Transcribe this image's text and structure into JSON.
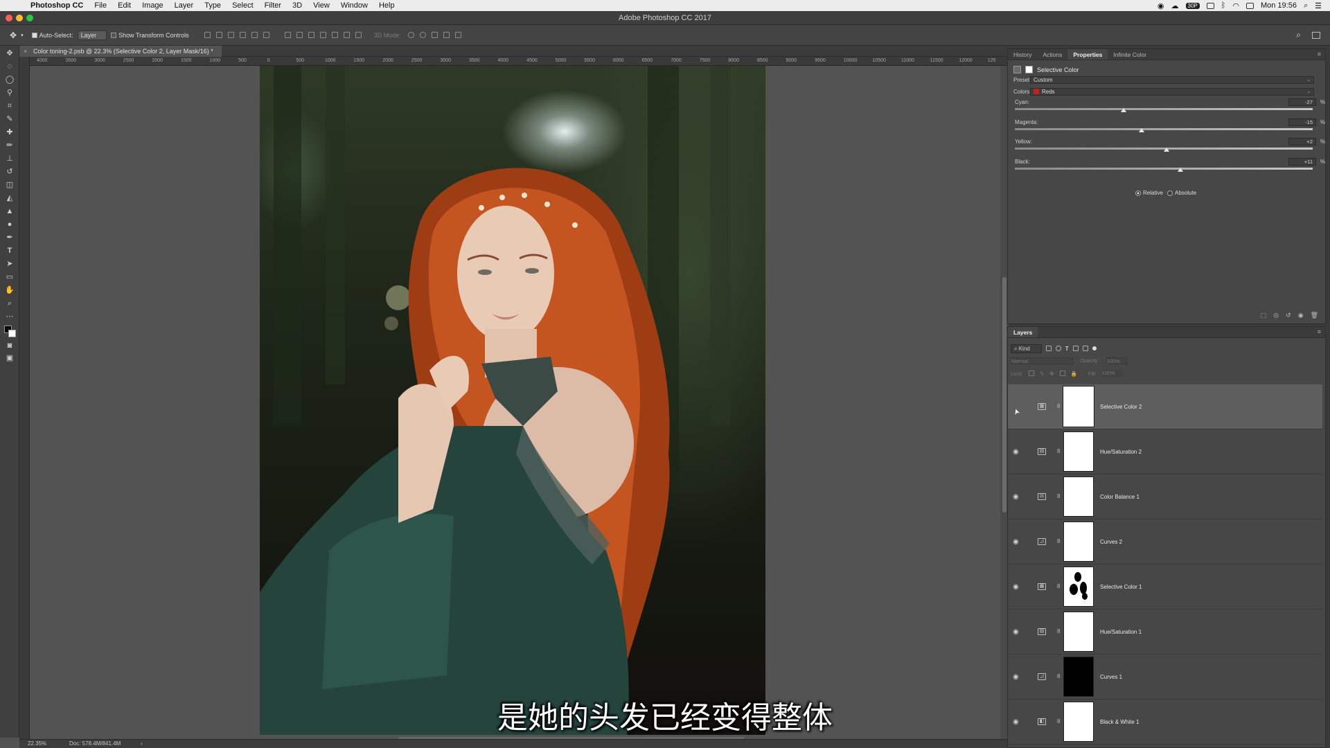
{
  "menubar": {
    "app": "Photoshop CC",
    "items": [
      "File",
      "Edit",
      "Image",
      "Layer",
      "Type",
      "Select",
      "Filter",
      "3D",
      "View",
      "Window",
      "Help"
    ],
    "clock": "Mon 19:56",
    "badge": "30P"
  },
  "window": {
    "title": "Adobe Photoshop CC 2017"
  },
  "options": {
    "auto_select_label": "Auto-Select:",
    "auto_select_value": "Layer",
    "transform_label": "Show Transform Controls",
    "mode3d": "3D Mode:"
  },
  "document": {
    "tab_title": "Color toning-2.psb @ 22.3% (Selective Color 2, Layer Mask/16) *",
    "zoom": "22.35%",
    "doc_info": "Doc: 578.4M/841.4M"
  },
  "ruler": {
    "ticks": [
      "4000",
      "3500",
      "3000",
      "2500",
      "2000",
      "1500",
      "1000",
      "500",
      "0",
      "500",
      "1000",
      "1500",
      "2000",
      "2500",
      "3000",
      "3500",
      "4000",
      "4500",
      "5000",
      "5500",
      "6000",
      "6500",
      "7000",
      "7500",
      "8000",
      "8500",
      "9000",
      "9500",
      "10000",
      "10500",
      "11000",
      "11500",
      "12000",
      "125"
    ]
  },
  "subtitle": "是她的头发已经变得整体",
  "properties_panel": {
    "tabs": [
      "History",
      "Actions",
      "Properties",
      "Infinite Color"
    ],
    "active_tab": "Properties",
    "title": "Selective Color",
    "preset_label": "Preset:",
    "preset_value": "Custom",
    "colors_label": "Colors:",
    "colors_value": "Reds",
    "colors_swatch": "#c0241b",
    "sliders": [
      {
        "label": "Cyan:",
        "value": "-27",
        "unit": "%",
        "percent": -27
      },
      {
        "label": "Magenta:",
        "value": "-15",
        "unit": "%",
        "percent": -15
      },
      {
        "label": "Yellow:",
        "value": "+2",
        "unit": "%",
        "percent": 2
      },
      {
        "label": "Black:",
        "value": "+11",
        "unit": "%",
        "percent": 11
      }
    ],
    "method_relative": "Relative",
    "method_absolute": "Absolute",
    "method_selected": "Relative"
  },
  "layers_panel": {
    "title": "Layers",
    "filter_kind": "Kind",
    "blend_mode": "Normal",
    "opacity_label": "Opacity:",
    "opacity_value": "100%",
    "lock_label": "Lock:",
    "fill_label": "Fill:",
    "fill_value": "100%",
    "layers": [
      {
        "name": "Selective Color 2",
        "type": "selective-color",
        "mask": "white",
        "selected": true,
        "visible": false
      },
      {
        "name": "Hue/Saturation 2",
        "type": "hue-saturation",
        "mask": "white",
        "selected": false,
        "visible": true
      },
      {
        "name": "Color Balance 1",
        "type": "color-balance",
        "mask": "white",
        "selected": false,
        "visible": true
      },
      {
        "name": "Curves 2",
        "type": "curves",
        "mask": "white",
        "selected": false,
        "visible": true
      },
      {
        "name": "Selective Color 1",
        "type": "selective-color",
        "mask": "painted",
        "selected": false,
        "visible": true
      },
      {
        "name": "Hue/Saturation 1",
        "type": "hue-saturation",
        "mask": "white",
        "selected": false,
        "visible": true
      },
      {
        "name": "Curves 1",
        "type": "curves",
        "mask": "black",
        "selected": false,
        "visible": true
      },
      {
        "name": "Black & White 1",
        "type": "black-white",
        "mask": "white",
        "selected": false,
        "visible": true
      }
    ]
  }
}
